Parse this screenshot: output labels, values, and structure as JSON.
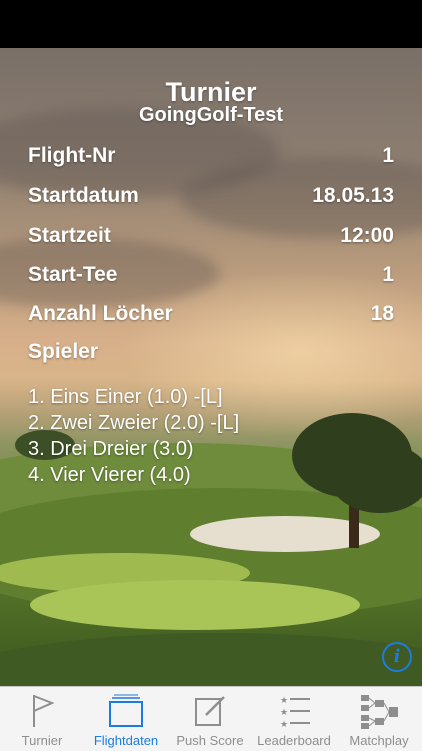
{
  "header": {
    "title": "Turnier",
    "subtitle": "GoingGolf-Test"
  },
  "details": [
    {
      "label": "Flight-Nr",
      "value": "1"
    },
    {
      "label": "Startdatum",
      "value": "18.05.13"
    },
    {
      "label": "Startzeit",
      "value": "12:00"
    },
    {
      "label": "Start-Tee",
      "value": "1"
    },
    {
      "label": "Anzahl Löcher",
      "value": "18"
    }
  ],
  "players_heading": "Spieler",
  "players": [
    "1. Eins Einer (1.0) -[L]",
    "2. Zwei Zweier (2.0) -[L]",
    "3. Drei Dreier (3.0)",
    "4. Vier Vierer (4.0)"
  ],
  "info_icon": "info-icon",
  "tabs": [
    {
      "label": "Turnier",
      "icon": "flag-icon"
    },
    {
      "label": "Flightdaten",
      "icon": "card-icon",
      "active": true
    },
    {
      "label": "Push Score",
      "icon": "edit-icon"
    },
    {
      "label": "Leaderboard",
      "icon": "list-icon"
    },
    {
      "label": "Matchplay",
      "icon": "bracket-icon"
    }
  ],
  "colors": {
    "accent": "#1a7be3",
    "tab_inactive": "#8e8e8e",
    "tabbar_bg": "#f4f4f4"
  }
}
